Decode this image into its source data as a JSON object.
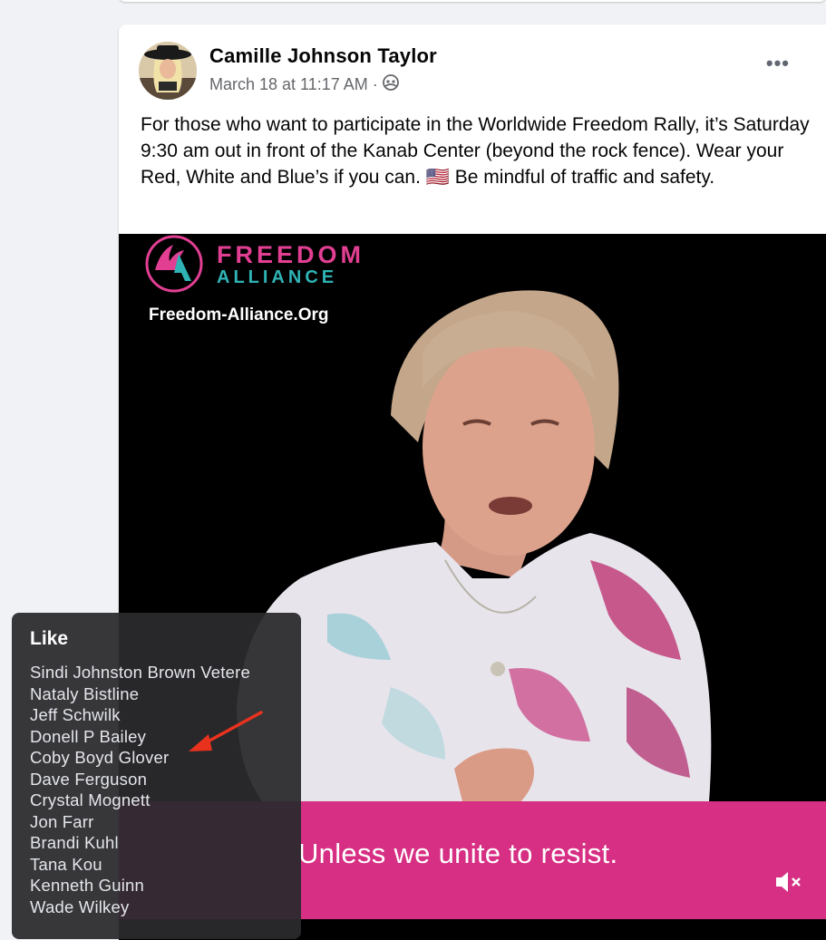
{
  "post": {
    "author": "Camille Johnson Taylor",
    "timestamp": "March 18 at 11:17 AM ·",
    "audience_icon": "friends-icon",
    "more_icon": "more-options-icon",
    "text": "For those who want to participate in the Worldwide Freedom Rally, it’s Saturday 9:30 am out in front of the Kanab Center (beyond the rock fence). Wear your Red, White and Blue’s if you can. 🇺🇸 Be mindful of traffic and safety."
  },
  "video": {
    "brand_name_line1": "FREEDOM",
    "brand_name_line2": "ALLIANCE",
    "brand_url": "Freedom-Alliance.Org",
    "caption": "Unless we unite to resist.",
    "mute_icon": "muted-speaker-icon"
  },
  "likes_tooltip": {
    "title": "Like",
    "names": [
      "Sindi Johnston Brown Vetere",
      "Nataly Bistline",
      "Jeff Schwilk",
      "Donell P Bailey",
      "Coby Boyd Glover",
      "Dave Ferguson",
      "Crystal Mognett",
      "Jon Farr",
      "Brandi Kuhl",
      "Tana Kou",
      "Kenneth Guinn",
      "Wade Wilkey"
    ]
  },
  "colors": {
    "brand_pink": "#e23f93",
    "brand_teal": "#2fb3b5",
    "caption_bar": "#d62f83",
    "annotation_arrow": "#e8321e"
  }
}
